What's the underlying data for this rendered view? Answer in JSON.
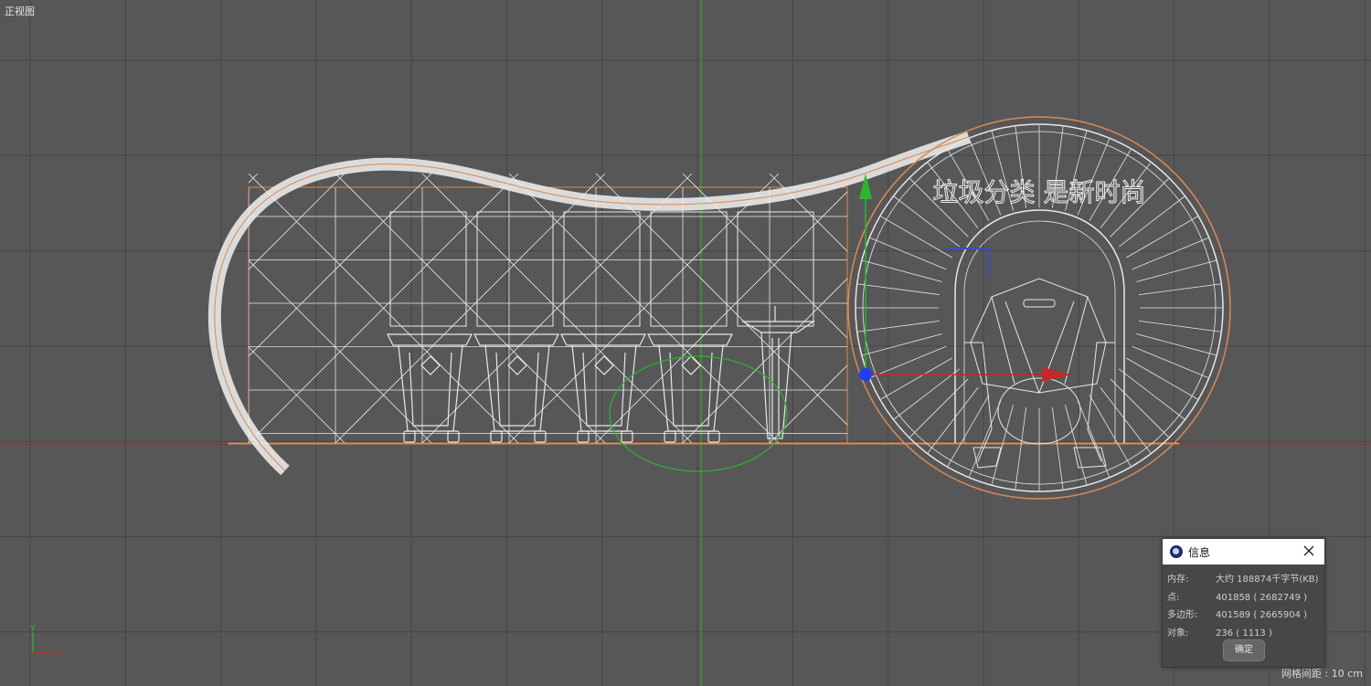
{
  "viewport": {
    "view_name": "正视图",
    "grid_spacing": "网格间距 : 10 cm",
    "axis_gizmo": {
      "y_label": "Y",
      "x_label": "X"
    },
    "model_text": "垃圾分类 是新时尚",
    "colors": {
      "background": "#575757",
      "grid": "#464646",
      "wire": "#e8e8e8",
      "selection": "#d98a52",
      "y_axis": "#2db52d",
      "x_axis": "#c62828",
      "z_axis": "#1f3fff"
    }
  },
  "info_dialog": {
    "title": "信息",
    "icon": "cinema4d-logo-icon",
    "close_icon": "close-icon",
    "rows": [
      {
        "label": "内存:",
        "value": "大约 188874千字节(KB)"
      },
      {
        "label": "点:",
        "value": "401858 ( 2682749 )"
      },
      {
        "label": "多边形:",
        "value": "401589 ( 2665904 )"
      },
      {
        "label": "对象:",
        "value": "236 ( 1113 )"
      }
    ],
    "ok_label": "确定"
  }
}
